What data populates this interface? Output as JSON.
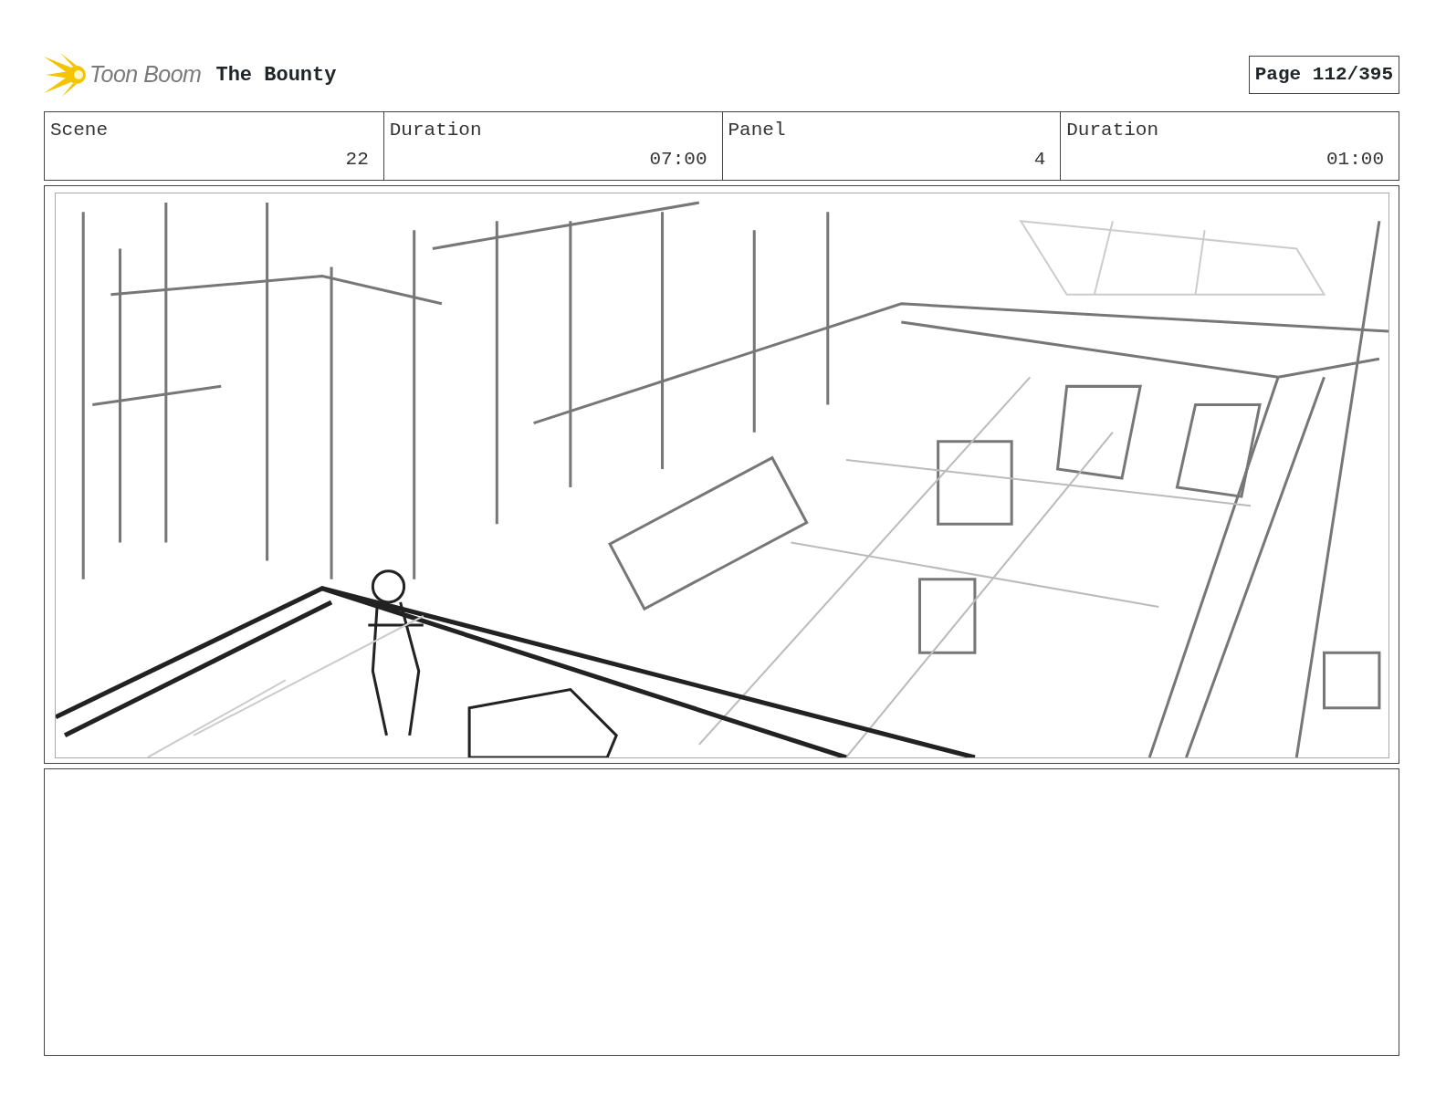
{
  "header": {
    "logo_text": "Toon Boom",
    "title": "The Bounty",
    "page": "Page 112/395"
  },
  "fields": [
    {
      "label": "Scene",
      "value": "22"
    },
    {
      "label": "Duration",
      "value": "07:00"
    },
    {
      "label": "Panel",
      "value": "4"
    },
    {
      "label": "Duration",
      "value": "01:00"
    }
  ]
}
